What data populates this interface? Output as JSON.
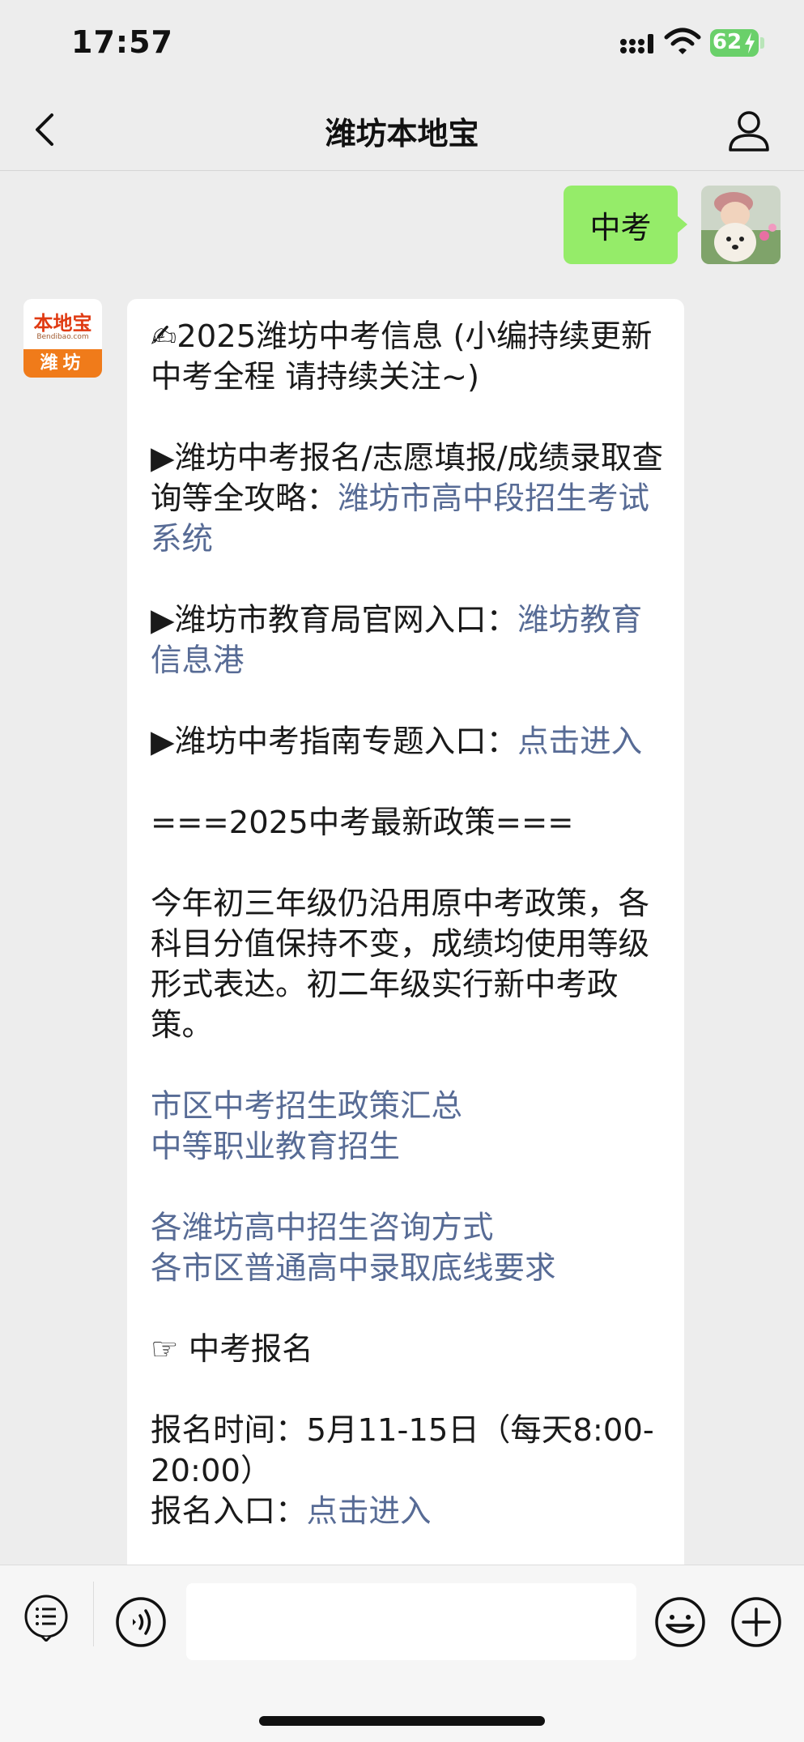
{
  "status_bar": {
    "time": "17:57",
    "battery": "62"
  },
  "nav": {
    "title": "潍坊本地宝"
  },
  "chat": {
    "sent_text": "中考",
    "bot_avatar": {
      "logo": "本地宝",
      "logo_sub": "Bendibao.com",
      "city": "潍坊"
    },
    "reply": {
      "title": "✍2025潍坊中考信息 (小编持续更新中考全程 请持续关注~)",
      "item1_text": "▶潍坊中考报名/志愿填报/成绩录取查询等全攻略：",
      "item1_link": "潍坊市高中段招生考试系统",
      "item2_text": "▶潍坊市教育局官网入口：",
      "item2_link": "潍坊教育信息港",
      "item3_text": "▶潍坊中考指南专题入口：",
      "item3_link": "点击进入",
      "policy_heading": "===2025中考最新政策===",
      "policy_text": "今年初三年级仍沿用原中考政策，各科目分值保持不变，成绩均使用等级形式表达。初二年级实行新中考政策。",
      "link_a": "市区中考招生政策汇总",
      "link_b": "中等职业教育招生",
      "link_c": "各潍坊高中招生咨询方式",
      "link_d": "各市区普通高中录取底线要求",
      "signup_heading": "☞ 中考报名",
      "signup_time": "报名时间：5月11-15日（每天8:00-20:00）",
      "signup_entry_label": "报名入口：",
      "signup_entry_link": "点击进入"
    }
  },
  "input_bar": {
    "placeholder": ""
  }
}
